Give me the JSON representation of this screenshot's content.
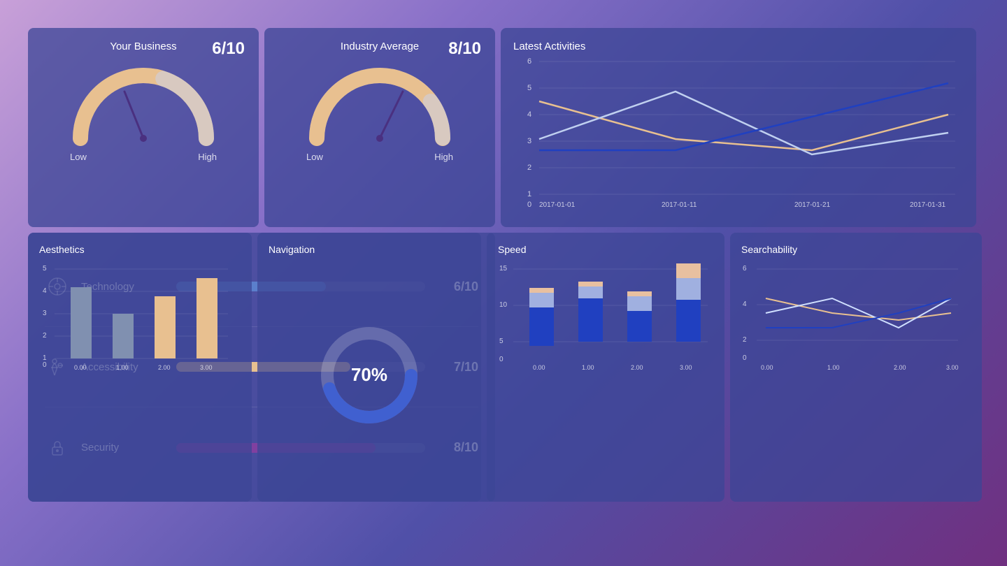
{
  "gauges": {
    "business": {
      "title": "Your Business",
      "score": "6/10",
      "value": 0.6,
      "low": "Low",
      "high": "High"
    },
    "industry": {
      "title": "Industry Average",
      "score": "8/10",
      "value": 0.8,
      "low": "Low",
      "high": "High"
    }
  },
  "metrics": [
    {
      "name": "Technology",
      "score": "6/10",
      "value": 0.6,
      "color": "#5b7fcc"
    },
    {
      "name": "Accessibility",
      "score": "7/10",
      "value": 0.7,
      "color": "#e8c090"
    },
    {
      "name": "Security",
      "score": "8/10",
      "value": 0.8,
      "color": "#8040a0"
    }
  ],
  "activities": {
    "title": "Latest Activities",
    "xLabels": [
      "2017-01-01",
      "2017-01-11",
      "2017-01-21",
      "2017-01-31"
    ],
    "yLabels": [
      0,
      1,
      2,
      3,
      4,
      5,
      6
    ],
    "series": [
      {
        "name": "orange",
        "color": "#e8c090",
        "points": [
          4.2,
          2.5,
          2.0,
          3.6
        ]
      },
      {
        "name": "white",
        "color": "#c0d0f0",
        "points": [
          2.5,
          4.5,
          1.8,
          2.8
        ]
      },
      {
        "name": "blue",
        "color": "#2040c0",
        "points": [
          2.0,
          2.0,
          3.5,
          5.0
        ]
      }
    ]
  },
  "aesthetics": {
    "title": "Aesthetics",
    "xLabels": [
      "0.00",
      "1.00",
      "2.00",
      "3.00"
    ],
    "yLabels": [
      0,
      1,
      2,
      3,
      4,
      5
    ],
    "bars": [
      {
        "x": "0.00",
        "value": 4,
        "color": "#8090b0"
      },
      {
        "x": "1.00",
        "value": 2.5,
        "color": "#8090b0"
      },
      {
        "x": "2.00",
        "value": 3.5,
        "color": "#e8c090"
      },
      {
        "x": "3.00",
        "value": 4.5,
        "color": "#e8c090"
      }
    ]
  },
  "navigation": {
    "title": "Navigation",
    "percent": "70%",
    "value": 70
  },
  "speed": {
    "title": "Speed",
    "xLabels": [
      "0.00",
      "1.00",
      "2.00",
      "3.00"
    ],
    "yLabels": [
      0,
      5,
      10,
      15
    ],
    "bars": [
      {
        "x": "0.00",
        "bottom": 3,
        "mid": 3,
        "top": 1,
        "colors": [
          "#2040c0",
          "#a0b0e0",
          "#e8c0a0"
        ]
      },
      {
        "x": "1.00",
        "bottom": 4,
        "mid": 2.5,
        "top": 1,
        "colors": [
          "#2040c0",
          "#a0b0e0",
          "#e8c0a0"
        ]
      },
      {
        "x": "2.00",
        "bottom": 2,
        "mid": 3,
        "top": 1,
        "colors": [
          "#2040c0",
          "#a0b0e0",
          "#e8c0a0"
        ]
      },
      {
        "x": "3.00",
        "bottom": 4,
        "mid": 4.5,
        "top": 3,
        "colors": [
          "#2040c0",
          "#a0b0e0",
          "#e8c0a0"
        ]
      }
    ]
  },
  "searchability": {
    "title": "Searchability",
    "xLabels": [
      "0.00",
      "1.00",
      "2.00",
      "3.00"
    ],
    "yLabels": [
      0,
      2,
      4,
      6
    ],
    "series": [
      {
        "name": "orange",
        "color": "#e8c090",
        "points": [
          4,
          3,
          2.5,
          3
        ]
      },
      {
        "name": "white",
        "color": "#d0e0ff",
        "points": [
          3,
          4,
          2,
          4
        ]
      },
      {
        "name": "blue",
        "color": "#2040c0",
        "points": [
          2,
          2,
          3,
          4
        ]
      }
    ]
  }
}
